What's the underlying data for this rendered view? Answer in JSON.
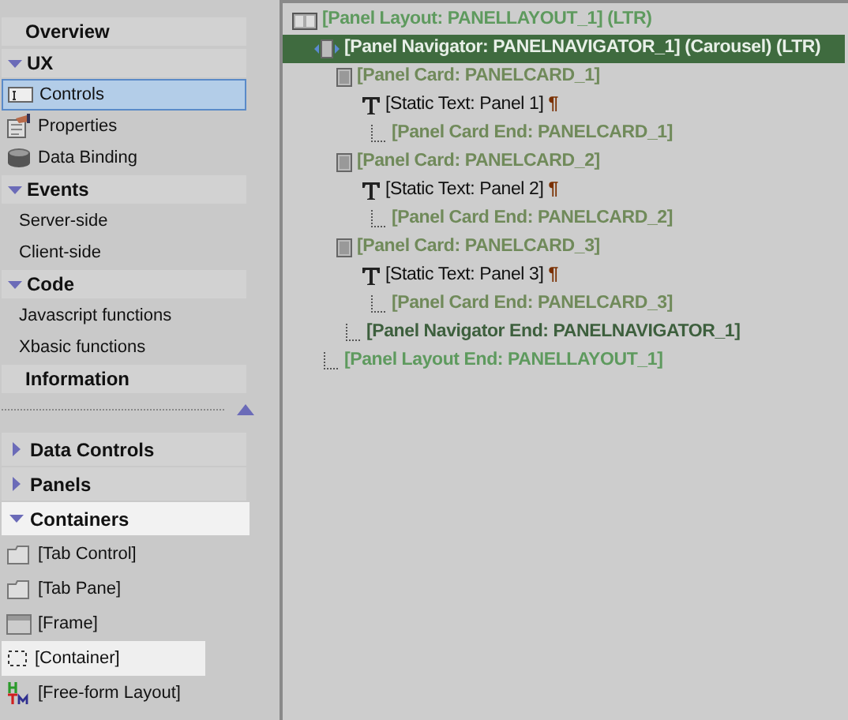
{
  "sidebar": {
    "items": [
      {
        "kind": "header",
        "label": "Overview"
      },
      {
        "kind": "header",
        "label": "UX",
        "expanded": true
      },
      {
        "kind": "item",
        "label": "Controls",
        "selected": true
      },
      {
        "kind": "item",
        "label": "Properties",
        "selected": false
      },
      {
        "kind": "item",
        "label": "Data Binding",
        "selected": false
      },
      {
        "kind": "header",
        "label": "Events",
        "expanded": true
      },
      {
        "kind": "item",
        "label": "Server-side",
        "selected": false
      },
      {
        "kind": "item",
        "label": "Client-side",
        "selected": false
      },
      {
        "kind": "header",
        "label": "Code",
        "expanded": true
      },
      {
        "kind": "item",
        "label": "Javascript functions",
        "selected": false
      },
      {
        "kind": "item",
        "label": "Xbasic functions",
        "selected": false
      },
      {
        "kind": "header",
        "label": "Information"
      }
    ]
  },
  "palette": {
    "groups": [
      {
        "label": "Data Controls",
        "expanded": false,
        "highlighted": false
      },
      {
        "label": "Panels",
        "expanded": false,
        "highlighted": false
      },
      {
        "label": "Containers",
        "expanded": true,
        "highlighted": true,
        "items": [
          {
            "label": "[Tab Control]",
            "highlighted": false
          },
          {
            "label": "[Tab Pane]",
            "highlighted": false
          },
          {
            "label": "[Frame]",
            "highlighted": false
          },
          {
            "label": "[Container]",
            "highlighted": true
          },
          {
            "label": "[Free-form Layout]",
            "highlighted": false
          }
        ]
      }
    ]
  },
  "tree": [
    {
      "kind": "layout",
      "label": "[Panel Layout: PANELLAYOUT_1] (LTR)",
      "selected": false,
      "children": [
        {
          "kind": "navigator",
          "label": "[Panel Navigator: PANELNAVIGATOR_1] (Carousel) (LTR)",
          "selected": true,
          "children": [
            {
              "kind": "card",
              "label": "[Panel Card: PANELCARD_1]",
              "selected": false,
              "children": [
                {
                  "kind": "text",
                  "label": "[Static Text: Panel 1]",
                  "mark": "¶",
                  "selected": false
                },
                {
                  "kind": "card-end",
                  "label": "[Panel Card End: PANELCARD_1]",
                  "selected": false
                }
              ]
            },
            {
              "kind": "card",
              "label": "[Panel Card: PANELCARD_2]",
              "selected": false,
              "children": [
                {
                  "kind": "text",
                  "label": "[Static Text: Panel 2]",
                  "mark": "¶",
                  "selected": false
                },
                {
                  "kind": "card-end",
                  "label": "[Panel Card End: PANELCARD_2]",
                  "selected": false
                }
              ]
            },
            {
              "kind": "card",
              "label": "[Panel Card: PANELCARD_3]",
              "selected": false,
              "children": [
                {
                  "kind": "text",
                  "label": "[Static Text: Panel 3]",
                  "mark": "¶",
                  "selected": false
                },
                {
                  "kind": "card-end",
                  "label": "[Panel Card End: PANELCARD_3]",
                  "selected": false
                }
              ]
            },
            {
              "kind": "nav-end",
              "label": "[Panel Navigator End: PANELNAVIGATOR_1]",
              "selected": false
            }
          ]
        },
        {
          "kind": "layout-end",
          "label": "[Panel Layout End: PANELLAYOUT_1]",
          "selected": false
        }
      ]
    }
  ]
}
